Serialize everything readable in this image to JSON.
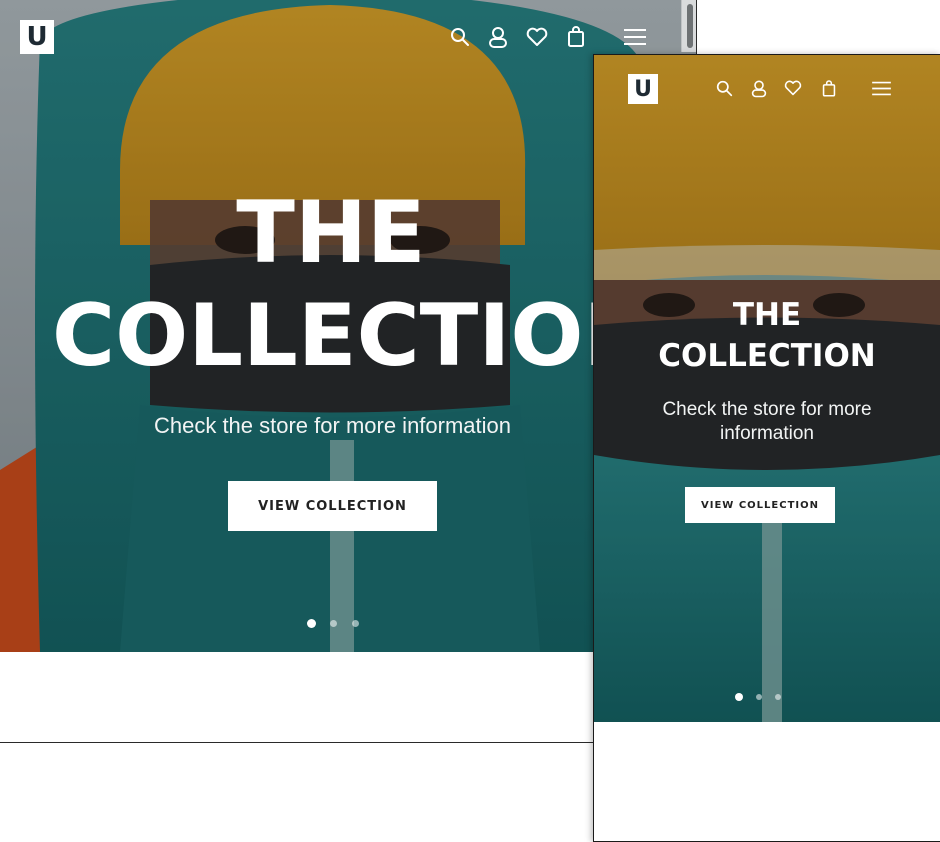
{
  "brand": {
    "logo_letter": "U"
  },
  "hero": {
    "title_line1": "THE",
    "title_line2": "COLLECTION",
    "subtitle": "Check the store for more information",
    "subtitle_mobile_line1": "Check the store for more",
    "subtitle_mobile_line2": "information",
    "cta_label": "VIEW COLLECTION",
    "slides_total": 3,
    "active_slide": 1
  },
  "nav_icons": [
    "search-icon",
    "account-icon",
    "wishlist-heart-icon",
    "shopping-bag-icon",
    "hamburger-menu-icon"
  ],
  "colors": {
    "beanie": "#d9a22a",
    "jacket": "#1f7b7d",
    "jacket_dark": "#145a5c",
    "orange_gear": "#e0541f",
    "overlay_text": "#ffffff",
    "logo_bg": "#ffffff",
    "logo_text": "#1e2a33"
  }
}
